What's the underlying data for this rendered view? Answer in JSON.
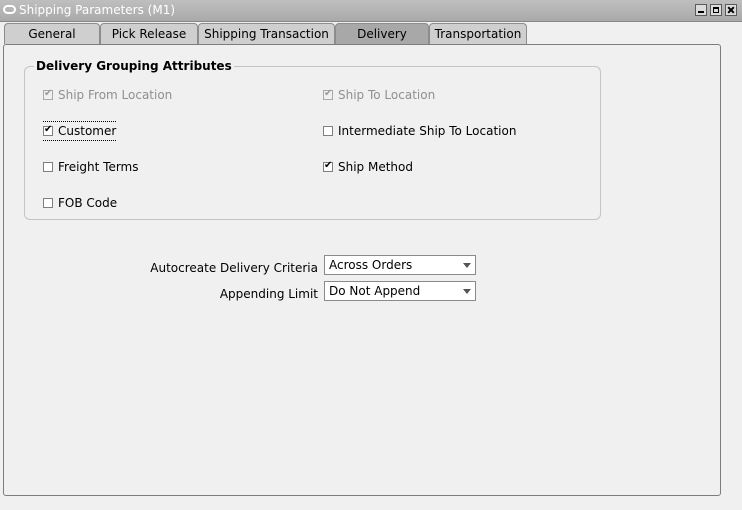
{
  "window": {
    "title": "Shipping Parameters (M1)"
  },
  "tabs": [
    {
      "label": "General"
    },
    {
      "label": "Pick Release"
    },
    {
      "label": "Shipping Transaction"
    },
    {
      "label": "Delivery"
    },
    {
      "label": "Transportation"
    }
  ],
  "active_tab": "Delivery",
  "grouping": {
    "title": "Delivery Grouping Attributes",
    "items": [
      {
        "label": "Ship From Location",
        "checked": true,
        "enabled": false
      },
      {
        "label": "Ship To Location",
        "checked": true,
        "enabled": false
      },
      {
        "label": "Customer",
        "checked": true,
        "enabled": true
      },
      {
        "label": "Intermediate Ship To Location",
        "checked": false,
        "enabled": true
      },
      {
        "label": "Freight Terms",
        "checked": false,
        "enabled": true
      },
      {
        "label": "Ship Method",
        "checked": true,
        "enabled": true
      },
      {
        "label": "FOB Code",
        "checked": false,
        "enabled": true
      }
    ]
  },
  "fields": {
    "autocreate": {
      "label": "Autocreate Delivery Criteria",
      "value": "Across Orders"
    },
    "appending": {
      "label": "Appending Limit",
      "value": "Do Not Append"
    }
  }
}
